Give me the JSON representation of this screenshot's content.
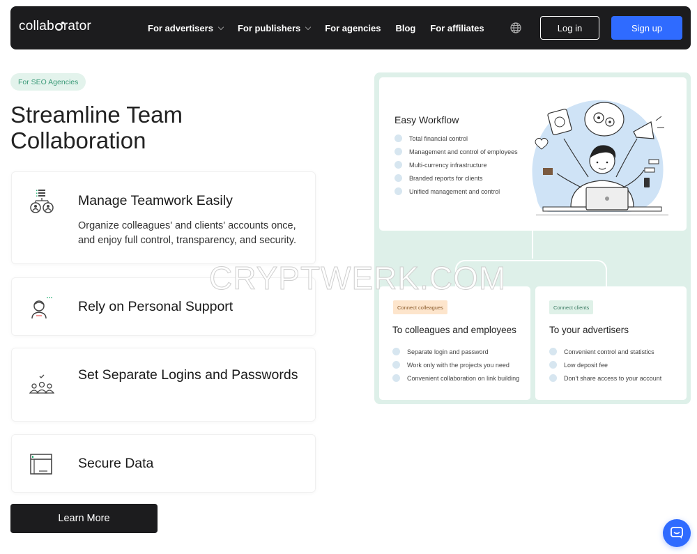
{
  "nav": {
    "logo": "collaborator",
    "items": [
      {
        "label": "For advertisers",
        "dropdown": true
      },
      {
        "label": "For publishers",
        "dropdown": true
      },
      {
        "label": "For agencies",
        "dropdown": false
      },
      {
        "label": "Blog",
        "dropdown": false
      },
      {
        "label": "For affiliates",
        "dropdown": false
      }
    ],
    "login_label": "Log in",
    "signup_label": "Sign up",
    "globe_icon": "globe-icon"
  },
  "hero": {
    "tag": "For SEO Agencies",
    "headline": "Streamline Team Collaboration",
    "features": [
      {
        "title": "Manage Teamwork Easily",
        "description": "Organize colleagues' and clients' accounts once, and enjoy full control, transparency, and security.",
        "icon": "team-hierarchy-icon"
      },
      {
        "title": "Rely on Personal Support",
        "description": "",
        "icon": "support-agent-icon"
      },
      {
        "title": "Set Separate Logins and Passwords",
        "description": "",
        "icon": "users-check-icon"
      },
      {
        "title": "Secure Data",
        "description": "",
        "icon": "secure-data-icon"
      }
    ],
    "learn_more_label": "Learn More"
  },
  "illustration": {
    "workflow_title": "Easy Workflow",
    "workflow_items": [
      "Total financial control",
      "Management and control of employees",
      "Multi-currency infrastructure",
      "Branded reports for clients",
      "Unified management and control"
    ],
    "colleagues": {
      "pill": "Connect colleagues",
      "title": "To colleagues and employees",
      "items": [
        "Separate login and password",
        "Work only with the projects you need",
        "Convenient collaboration on link building"
      ]
    },
    "clients": {
      "pill": "Connect clients",
      "title": "To your advertisers",
      "items": [
        "Convenient control and statistics",
        "Low deposit fee",
        "Don't share access to your account"
      ]
    }
  },
  "watermark": "CRYPTWERK.COM",
  "colors": {
    "accent": "#2f6bff",
    "dark": "#1c1c1e",
    "panel": "#def0e9",
    "tag_bg": "#e3f3ec",
    "tag_text": "#3a9a78"
  }
}
